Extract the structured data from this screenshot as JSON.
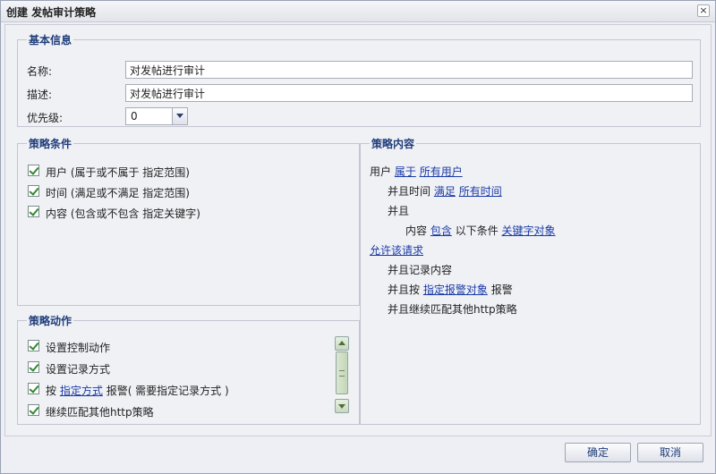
{
  "dialog": {
    "title": "创建 发帖审计策略",
    "close_label": "×"
  },
  "basic": {
    "legend": "基本信息",
    "name_label": "名称:",
    "name_value": "对发帖进行审计",
    "desc_label": "描述:",
    "desc_value": "对发帖进行审计",
    "priority_label": "优先级:",
    "priority_value": "0"
  },
  "conditions": {
    "legend": "策略条件",
    "items": [
      {
        "label": "用户 (属于或不属于 指定范围)",
        "checked": true
      },
      {
        "label": "时间 (满足或不满足 指定范围)",
        "checked": true
      },
      {
        "label": "内容 (包含或不包含 指定关键字)",
        "checked": true
      }
    ]
  },
  "actions": {
    "legend": "策略动作",
    "items": [
      {
        "label": "设置控制动作",
        "checked": true
      },
      {
        "label": "设置记录方式",
        "checked": true
      },
      {
        "prefix": "按",
        "link": "指定方式",
        "suffix": "报警( 需要指定记录方式 )",
        "checked": true
      },
      {
        "label": "继续匹配其他http策略",
        "checked": true
      }
    ]
  },
  "content": {
    "legend": "策略内容",
    "line1": {
      "text": "用户",
      "link1": "属于",
      "link2": "所有用户"
    },
    "line2": {
      "text": "并且时间",
      "link1": "满足",
      "link2": "所有时间"
    },
    "line3": {
      "text": "并且"
    },
    "line4": {
      "text": "内容",
      "link1": "包含",
      "middle": "以下条件",
      "link2": "关键字对象"
    },
    "line5": {
      "link": "允许该请求"
    },
    "line6": {
      "text": "并且记录内容"
    },
    "line7": {
      "prefix": "并且按",
      "link": "指定报警对象",
      "suffix": "报警"
    },
    "line8": {
      "text": "并且继续匹配其他http策略"
    }
  },
  "footer": {
    "ok_label": "确定",
    "cancel_label": "取消"
  },
  "colors": {
    "accent": "#1f3d7a",
    "link": "#1a3aa8",
    "check": "#2e8a2e"
  }
}
